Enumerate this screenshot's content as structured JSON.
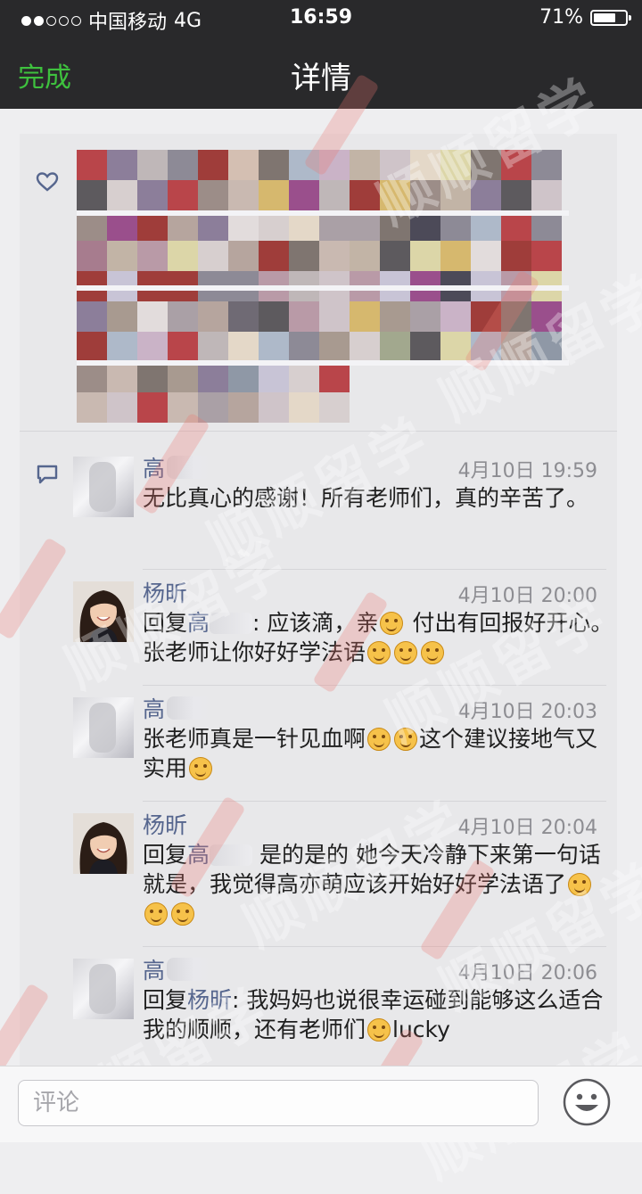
{
  "status_bar": {
    "carrier": "中国移动",
    "network": "4G",
    "time": "16:59",
    "battery": "71%",
    "battery_level": 0.71,
    "signal_strength": 2
  },
  "nav": {
    "done_label": "完成",
    "title": "详情"
  },
  "icons": {
    "like": "heart-icon",
    "comments": "comment-icon",
    "emoji_picker": "smiley-icon"
  },
  "colors": {
    "accent_green": "#3ec13e",
    "name_blue": "#56668e",
    "nav_bg": "#29292b"
  },
  "comments": [
    {
      "name": "高",
      "time": "4月10日 19:59",
      "text": "无比真心的感谢！所有老师们，真的辛苦了。"
    },
    {
      "name": "杨昕",
      "time": "4月10日 20:00",
      "reply_prefix": "回复",
      "reply_to": "高",
      "text_a": ": 应该滴，亲",
      "text_b": " 付出有回报好开心。张老师让你好好学法语"
    },
    {
      "name": "高",
      "time": "4月10日 20:03",
      "text_a": "张老师真是一针见血啊",
      "text_b": "这个建议接地气又实用"
    },
    {
      "name": "杨昕",
      "time": "4月10日 20:04",
      "reply_prefix": "回复",
      "reply_to": "高",
      "text": " 是的是的 她今天冷静下来第一句话就是，我觉得高亦萌应该开始好好学法语了"
    },
    {
      "name": "高",
      "time": "4月10日 20:06",
      "reply_prefix": "回复",
      "reply_to": "杨昕",
      "text_a": ": 我妈妈也说很幸运碰到能够这么适合我的顺顺，还有老师们",
      "text_b": "lucky"
    }
  ],
  "input": {
    "placeholder": "评论"
  },
  "watermark": "顺顺留学"
}
